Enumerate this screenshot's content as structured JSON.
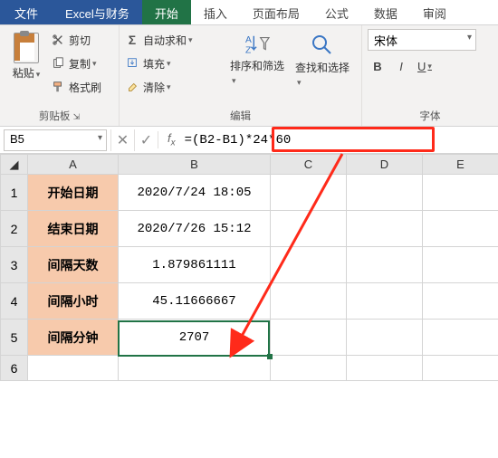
{
  "tabs": {
    "file": "文件",
    "excelFinance": "Excel与财务",
    "home": "开始",
    "insert": "插入",
    "layout": "页面布局",
    "formulas": "公式",
    "data": "数据",
    "review": "审阅"
  },
  "ribbon": {
    "clipboard": {
      "paste": "粘贴",
      "cut": "剪切",
      "copy": "复制",
      "formatPainter": "格式刷",
      "group": "剪贴板"
    },
    "editing": {
      "autosum": "自动求和",
      "fill": "填充",
      "clear": "清除",
      "sortFilter": "排序和筛选",
      "findSelect": "查找和选择",
      "group": "编辑"
    },
    "font": {
      "name": "宋体",
      "bold": "B",
      "italic": "I",
      "underline": "U",
      "group": "字体"
    }
  },
  "namebox": "B5",
  "formula": "=(B2-B1)*24*60",
  "columns": [
    "A",
    "B",
    "C",
    "D",
    "E"
  ],
  "rows": [
    {
      "n": "1",
      "label": "开始日期",
      "value": "2020/7/24 18:05"
    },
    {
      "n": "2",
      "label": "结束日期",
      "value": "2020/7/26 15:12"
    },
    {
      "n": "3",
      "label": "间隔天数",
      "value": "1.879861111"
    },
    {
      "n": "4",
      "label": "间隔小时",
      "value": "45.11666667"
    },
    {
      "n": "5",
      "label": "间隔分钟",
      "value": "2707"
    }
  ],
  "emptyRow": "6"
}
